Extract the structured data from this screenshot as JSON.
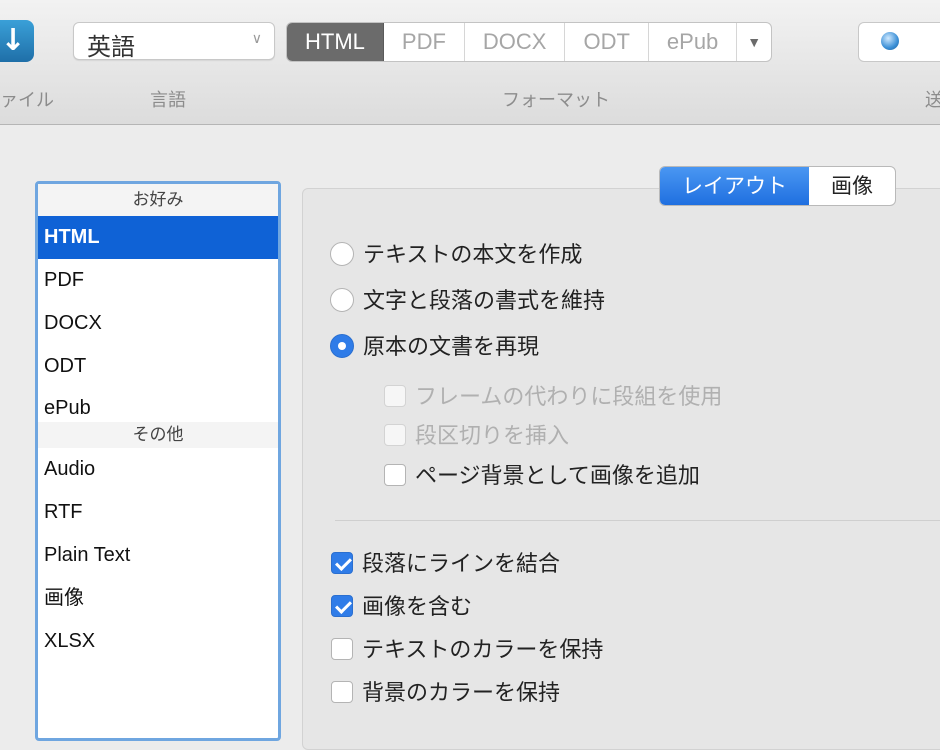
{
  "toolbar": {
    "file_label": "ァイル",
    "language": {
      "value": "英語",
      "label": "言語"
    },
    "formats": [
      {
        "label": "HTML",
        "active": true
      },
      {
        "label": "PDF",
        "active": false
      },
      {
        "label": "DOCX",
        "active": false
      },
      {
        "label": "ODT",
        "active": false
      },
      {
        "label": "ePub",
        "active": false
      }
    ],
    "format_label": "フォーマット",
    "send_label": "送"
  },
  "sidebar": {
    "favorites_header": "お好み",
    "favorites": [
      "HTML",
      "PDF",
      "DOCX",
      "ODT",
      "ePub"
    ],
    "selected": "HTML",
    "others_header": "その他",
    "others": [
      "Audio",
      "RTF",
      "Plain Text",
      "画像",
      "XLSX"
    ]
  },
  "tabs": {
    "layout": "レイアウト",
    "image": "画像",
    "active": "layout"
  },
  "layout_options": {
    "radios": [
      {
        "label": "テキストの本文を作成",
        "checked": false
      },
      {
        "label": "文字と段落の書式を維持",
        "checked": false
      },
      {
        "label": "原本の文書を再現",
        "checked": true
      }
    ],
    "sub_options": [
      {
        "label": "フレームの代わりに段組を使用",
        "checked": false,
        "enabled": false
      },
      {
        "label": "段区切りを挿入",
        "checked": false,
        "enabled": false
      },
      {
        "label": "ページ背景として画像を追加",
        "checked": false,
        "enabled": true
      }
    ],
    "checkboxes": [
      {
        "label": "段落にラインを結合",
        "checked": true
      },
      {
        "label": "画像を含む",
        "checked": true
      },
      {
        "label": "テキストのカラーを保持",
        "checked": false
      },
      {
        "label": "背景のカラーを保持",
        "checked": false
      }
    ]
  }
}
